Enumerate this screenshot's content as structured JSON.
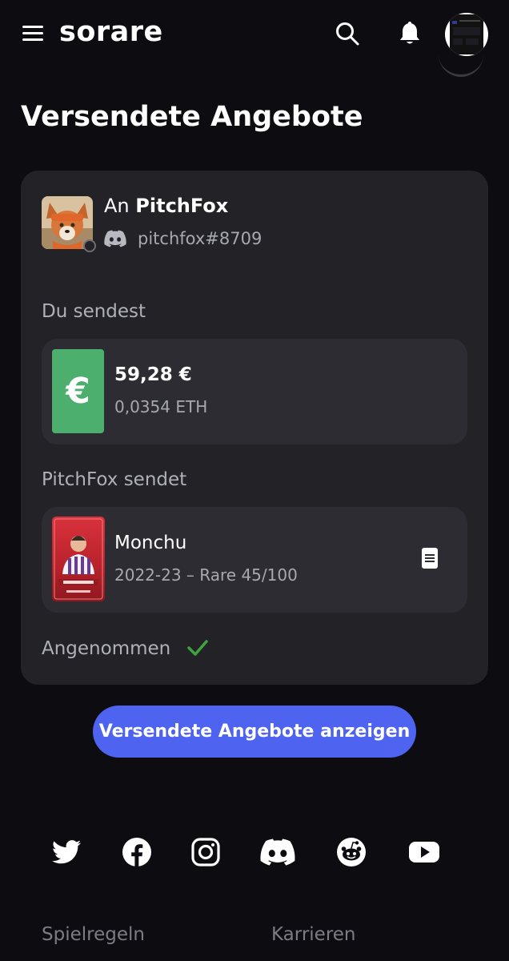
{
  "header": {
    "logo_text": "sorare",
    "menu_icon": "hamburger-menu-icon",
    "search_icon": "search-icon",
    "notification_icon": "bell-icon"
  },
  "page": {
    "title": "Versendete Angebote"
  },
  "offer": {
    "recipient_prefix": "An",
    "recipient_name": "PitchFox",
    "discord_handle": "pitchfox#8709",
    "you_send_label": "Du sendest",
    "currency_symbol": "€",
    "amount_eur": "59,28 €",
    "amount_eth": "0,0354 ETH",
    "they_send_label": "PitchFox sendet",
    "card": {
      "player_name": "Monchu",
      "meta": "2022-23 – Rare 45/100"
    },
    "status_label": "Angenommen"
  },
  "actions": {
    "show_sent_offers": "Versendete Angebote anzeigen"
  },
  "social_icons": [
    "twitter-icon",
    "facebook-icon",
    "instagram-icon",
    "discord-icon",
    "reddit-icon",
    "youtube-icon"
  ],
  "footer": {
    "links": [
      "Spielregeln",
      "Karrieren"
    ]
  },
  "colors": {
    "background": "#0d0d11",
    "card": "#222227",
    "item_box": "#2c2c32",
    "accent_blue": "#4e64f0",
    "euro_green": "#4caf6e",
    "check_green": "#3fa33f"
  }
}
